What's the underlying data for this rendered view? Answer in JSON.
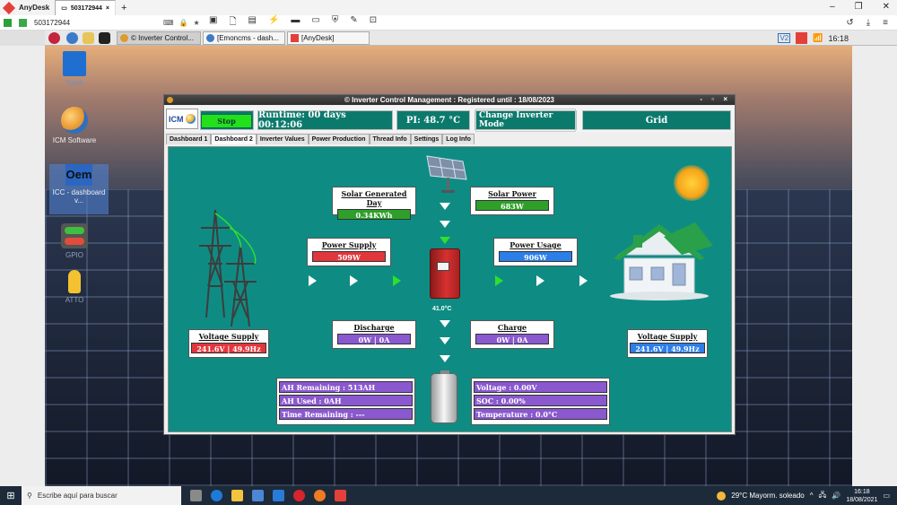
{
  "anydesk": {
    "app_name": "AnyDesk",
    "tab_label": "503172944",
    "address": "503172944",
    "new_tab": "+"
  },
  "pi_taskbar": {
    "tasks": [
      "© Inverter Control...",
      "[Emoncms - dash...",
      "[AnyDesk]"
    ],
    "clock": "16:18",
    "v2_label": "V2"
  },
  "desktop_icons": [
    {
      "label": "Trash",
      "icon": "trash-icon"
    },
    {
      "label": "ICM Software",
      "icon": "globe-icon"
    },
    {
      "label": "ICC - dashboard v...",
      "icon": "oem-icon",
      "glyph_text": "Oem"
    },
    {
      "label": "GPIO",
      "icon": "toggle-icon"
    },
    {
      "label": "ATTO",
      "icon": "bulb-icon"
    }
  ],
  "window": {
    "title": "© Inverter Control Management : Registered until : 18/08/2023",
    "controls": "- ▫ ×"
  },
  "toolbar": {
    "logo_text": "ICM",
    "stop_label": "Stop",
    "runtime": "Runtime: 00 days 00:12:06",
    "pi_temp": "PI: 48.7 °C",
    "mode_button": "Change Inverter Mode",
    "mode_value": "Grid"
  },
  "tabs": [
    "Dashboard 1",
    "Dashboard 2",
    "Inverter Values",
    "Power Production",
    "Thread Info",
    "Settings",
    "Log Info"
  ],
  "active_tab": "Dashboard 2",
  "dashboard": {
    "solar_generated": {
      "label": "Solar Generated Day",
      "value": "0.34KWh"
    },
    "solar_power": {
      "label": "Solar Power",
      "value": "683W"
    },
    "power_supply": {
      "label": "Power Supply",
      "value": "509W"
    },
    "power_usage": {
      "label": "Power Usage",
      "value": "906W"
    },
    "discharge": {
      "label": "Discharge",
      "value": "0W | 0A"
    },
    "charge": {
      "label": "Charge",
      "value": "0W | 0A"
    },
    "grid_voltage": {
      "label": "Voltage Supply",
      "value": "241.6V | 49.9Hz"
    },
    "house_voltage": {
      "label": "Voltage Supply",
      "value": "241.6V | 49.9Hz"
    },
    "inverter_temp": "41.0°C",
    "battery_left": [
      "AH Remaining : 513AH",
      "AH Used : 0AH",
      "Time Remaining :  ---"
    ],
    "battery_right": [
      "Voltage : 0.00V",
      "SOC : 0.00%",
      "Temperature : 0.0°C"
    ]
  },
  "windows_taskbar": {
    "search_placeholder": "Escribe aquí para buscar",
    "weather": "29°C  Mayorm. soleado",
    "time": "16:18",
    "date": "18/08/2021"
  },
  "colors": {
    "panel_teal": "#0e8c84",
    "toolbar_teal": "#0b7a6d",
    "stop_green": "#22e01a",
    "value_green": "#2ea02a",
    "value_red": "#e2363d",
    "value_blue": "#2c7ee8",
    "value_purple": "#8a58cf"
  }
}
